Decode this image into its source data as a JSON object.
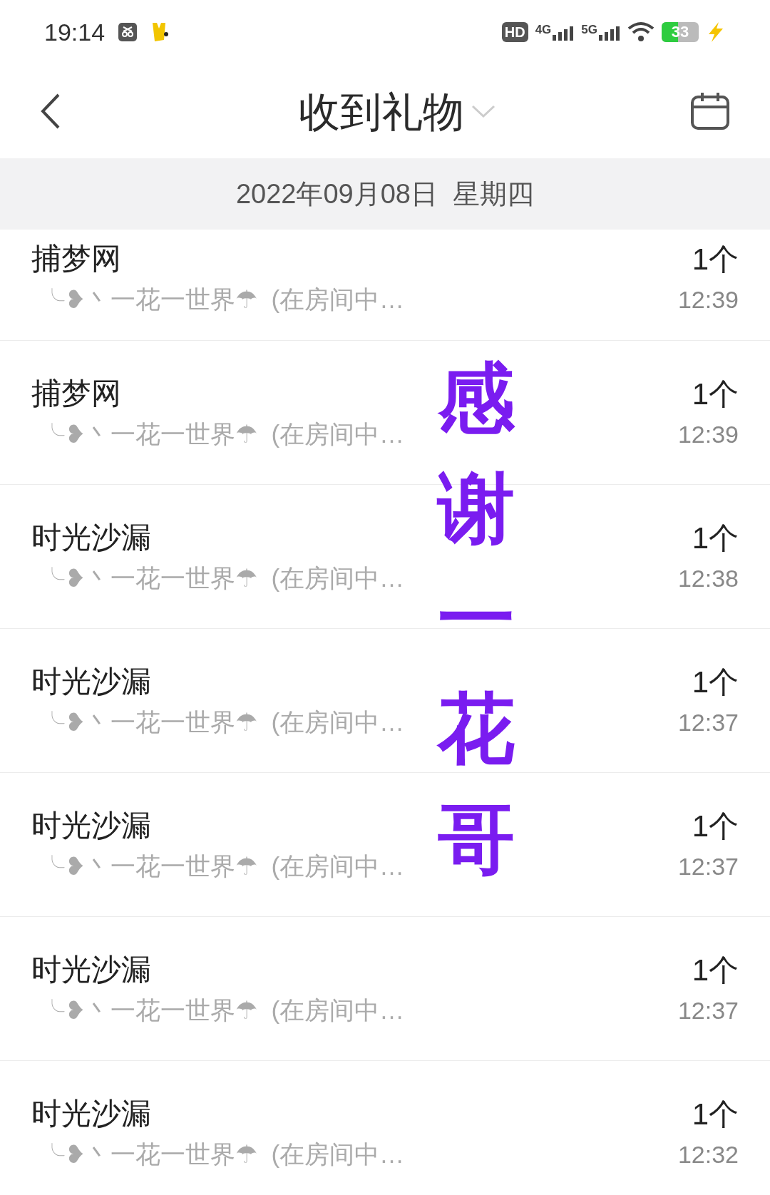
{
  "status_bar": {
    "time": "19:14",
    "hd": "HD",
    "sim1": "4G",
    "sim2": "5G",
    "battery": "33"
  },
  "header": {
    "title": "收到礼物"
  },
  "date_band": "2022年09月08日  星期四",
  "rows": [
    {
      "gift": "捕梦网",
      "sender": "╰❥丶一花一世界☂  (在房间中…",
      "count": "1个",
      "time": "12:39"
    },
    {
      "gift": "捕梦网",
      "sender": "╰❥丶一花一世界☂  (在房间中…",
      "count": "1个",
      "time": "12:39"
    },
    {
      "gift": "时光沙漏",
      "sender": "╰❥丶一花一世界☂  (在房间中…",
      "count": "1个",
      "time": "12:38"
    },
    {
      "gift": "时光沙漏",
      "sender": "╰❥丶一花一世界☂  (在房间中…",
      "count": "1个",
      "time": "12:37"
    },
    {
      "gift": "时光沙漏",
      "sender": "╰❥丶一花一世界☂  (在房间中…",
      "count": "1个",
      "time": "12:37"
    },
    {
      "gift": "时光沙漏",
      "sender": "╰❥丶一花一世界☂  (在房间中…",
      "count": "1个",
      "time": "12:37"
    },
    {
      "gift": "时光沙漏",
      "sender": "╰❥丶一花一世界☂  (在房间中…",
      "count": "1个",
      "time": "12:32"
    }
  ],
  "overlay_text": "感谢一花哥"
}
